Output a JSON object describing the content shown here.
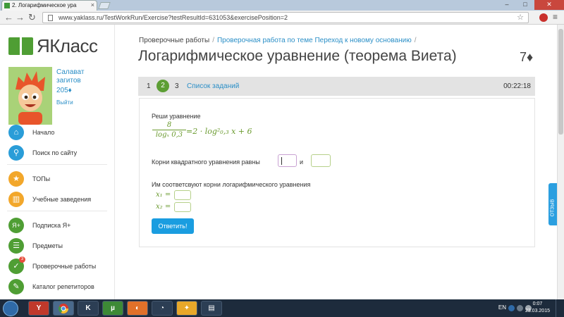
{
  "browser": {
    "tab_title": "2. Логарифмическое ура",
    "url": "www.yaklass.ru/TestWorkRun/Exercise?testResultId=631053&exercisePosition=2"
  },
  "sidebar": {
    "logo_text": "ЯКласс",
    "user_name": "Салават загитов",
    "user_points": "205♦",
    "logout": "Выйти",
    "items": [
      {
        "label": "Начало",
        "color": "#2a9dd8",
        "icon": "home-icon",
        "glyph": "⌂"
      },
      {
        "label": "Поиск по сайту",
        "color": "#2a9dd8",
        "icon": "search-icon",
        "glyph": "⚲"
      },
      {
        "label": "ТОПы",
        "color": "#f2a72b",
        "icon": "star-icon",
        "glyph": "★"
      },
      {
        "label": "Учебные заведения",
        "color": "#f2a72b",
        "icon": "building-icon",
        "glyph": "▥"
      },
      {
        "label": "Подписка Я+",
        "color": "#4f9e34",
        "icon": "plus-icon",
        "glyph": "Я+"
      },
      {
        "label": "Предметы",
        "color": "#4f9e34",
        "icon": "books-icon",
        "glyph": "☰"
      },
      {
        "label": "Проверочные работы",
        "color": "#4f9e34",
        "icon": "check-icon",
        "glyph": "✓",
        "badge": "3"
      },
      {
        "label": "Каталог репетиторов",
        "color": "#4f9e34",
        "icon": "tutor-icon",
        "glyph": "✎"
      }
    ]
  },
  "breadcrumb": {
    "item1": "Проверочные работы",
    "item2": "Проверочная работа по теме Переход к новому основанию",
    "separator": "/"
  },
  "title": "Логарифмическое уравнение (теорема Виета)",
  "score": "7♦",
  "task_nav": {
    "items": [
      "1",
      "2",
      "3"
    ],
    "list_label": "Список заданий",
    "timer": "00:22:18"
  },
  "exercise": {
    "instruction": "Реши уравнение",
    "formula": {
      "numerator": "8",
      "denominator": "logₓ 0,3",
      "rhs": "=2 · log²₀,₃ x + 6"
    },
    "roots_label": "Корни квадратного уравнения равны",
    "and_label": "и",
    "match_label": "Им соответсвуют корни логарифмического уравнения",
    "x1_label": "x₁ =",
    "x2_label": "x₂ =",
    "submit_label": "Ответить!"
  },
  "feedback_label": "ОТЗЫВ",
  "taskbar": {
    "lang": "EN",
    "time": "0:07",
    "date": "23.03.2015"
  }
}
